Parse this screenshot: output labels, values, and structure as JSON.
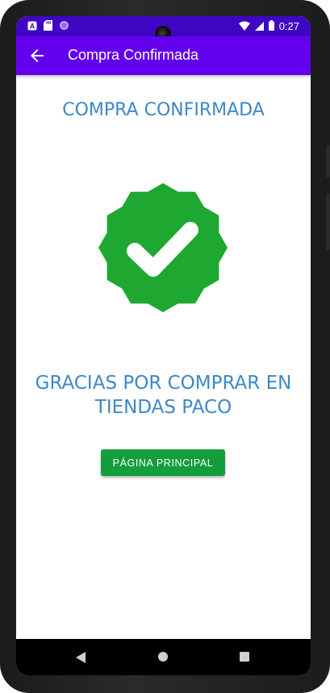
{
  "status_bar": {
    "time": "0:27",
    "notification_icons": [
      "a-icon",
      "sd-card-icon",
      "circle-icon"
    ],
    "system_icons": [
      "wifi-icon",
      "signal-icon",
      "battery-icon"
    ]
  },
  "app_bar": {
    "title": "Compra Confirmada",
    "back_icon": "arrow-back-icon"
  },
  "main": {
    "heading": "COMPRA CONFIRMADA",
    "badge_icon": "verified-check-icon",
    "thanks_line1": "GRACIAS POR COMPRAR EN",
    "thanks_line2": "TIENDAS PACO",
    "button_label": "PÁGINA PRINCIPAL"
  },
  "nav_bar": {
    "icons": [
      "nav-back-icon",
      "nav-home-icon",
      "nav-recents-icon"
    ]
  },
  "colors": {
    "status_bar": "#3f06c4",
    "app_bar": "#6200ee",
    "accent_text": "#3e88c7",
    "badge_green": "#1ea831",
    "button_green": "#149d3d"
  }
}
